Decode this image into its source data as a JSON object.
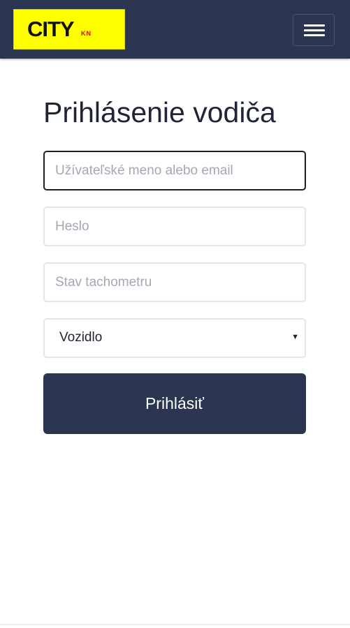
{
  "navbar": {
    "logo_text": "CITY",
    "logo_subtext": "KN",
    "menu_icon": "hamburger-menu-icon"
  },
  "login": {
    "title": "Prihlásenie vodiča",
    "username": {
      "placeholder": "Užívateľské meno alebo email",
      "value": ""
    },
    "password": {
      "placeholder": "Heslo",
      "value": ""
    },
    "tachometer": {
      "placeholder": "Stav tachometru",
      "value": ""
    },
    "vehicle": {
      "selected": "Vozidlo",
      "caret_icon": "dropdown-caret-icon"
    },
    "submit_label": "Prihlásiť"
  },
  "colors": {
    "navbar_bg": "#2b3450",
    "logo_bg": "#ffff00",
    "logo_sub": "#e00000",
    "button_bg": "#2b3450",
    "focus_border": "#1c1f27"
  }
}
